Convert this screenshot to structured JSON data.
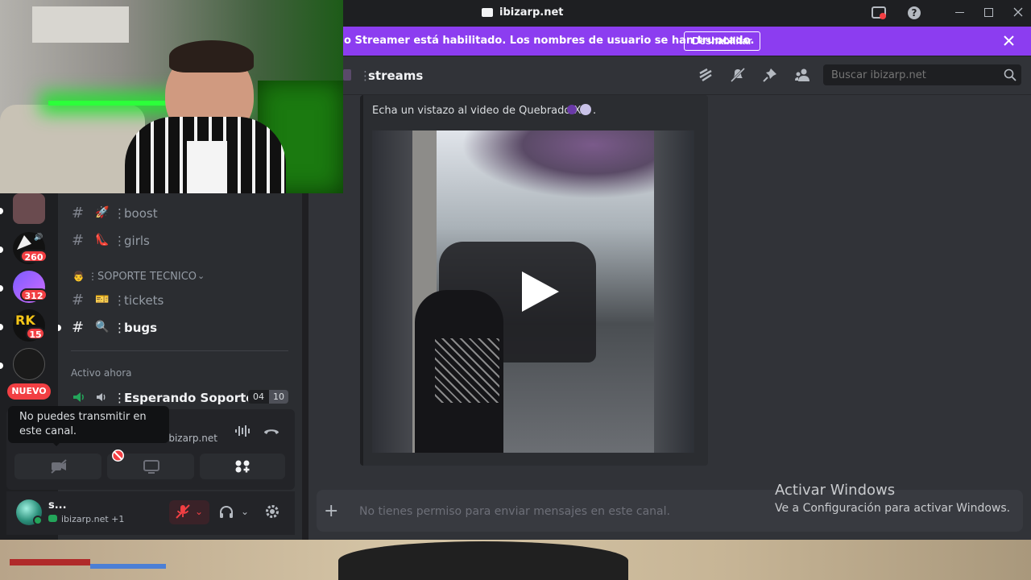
{
  "window": {
    "title": "ibizarp.net"
  },
  "banner": {
    "text": "o Streamer está habilitado. Los nombres de usuario se han truncado.",
    "button": "Deshabilitar"
  },
  "header": {
    "channel": "streams",
    "search_placeholder": "Buscar ibizarp.net"
  },
  "message": {
    "text": "Echa un vistazo al video de Quebrado X"
  },
  "composer": {
    "placeholder": "No tienes permiso para enviar mensajes en este canal."
  },
  "watermark": {
    "title": "Activar Windows",
    "subtitle": "Ve a Configuración para activar Windows."
  },
  "guilds": [
    {
      "badge": "260"
    },
    {
      "badge": "312"
    },
    {
      "badge": "15"
    },
    {
      "badge": ""
    }
  ],
  "guild_new_label": "NUEVO",
  "channels": [
    {
      "name": "boost",
      "emoji": "🚀"
    },
    {
      "name": "girls",
      "emoji": "👠"
    }
  ],
  "category": {
    "name": "SOPORTE TECNICO",
    "emoji": "👨"
  },
  "channels2": [
    {
      "name": "tickets",
      "emoji": "🎫"
    },
    {
      "name": "bugs",
      "emoji": "🔍"
    }
  ],
  "active_now": {
    "label": "Activo ahora",
    "voice_channel": "Esperando Soporte",
    "count_a": "04",
    "count_b": "10"
  },
  "tooltip": {
    "text": "No puedes transmitir en este canal."
  },
  "voice": {
    "server": "ibizarp.net"
  },
  "user": {
    "name": "s...",
    "status": "ibizarp.net +1"
  },
  "colors": {
    "banner": "#8c3df0",
    "badge": "#f23f43",
    "online": "#23a55a"
  }
}
